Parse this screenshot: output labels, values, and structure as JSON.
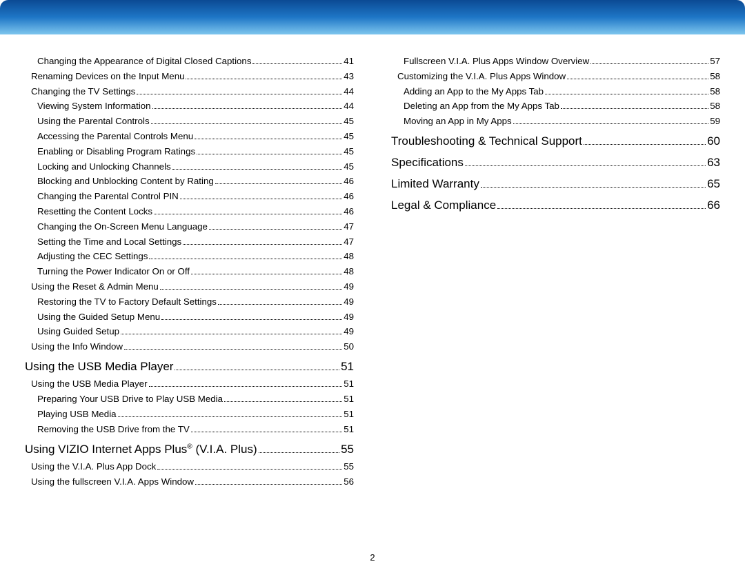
{
  "page_number": "2",
  "columns": [
    [
      {
        "level": 2,
        "type": "item",
        "label": "Changing the Appearance of Digital Closed Captions",
        "page": "41"
      },
      {
        "level": 1,
        "type": "item",
        "label": "Renaming Devices on the Input Menu",
        "page": "43"
      },
      {
        "level": 1,
        "type": "item",
        "label": "Changing the TV Settings",
        "page": "44"
      },
      {
        "level": 2,
        "type": "item",
        "label": "Viewing System Information",
        "page": "44"
      },
      {
        "level": 2,
        "type": "item",
        "label": "Using the Parental Controls",
        "page": "45"
      },
      {
        "level": 2,
        "type": "item",
        "label": "Accessing the Parental Controls Menu",
        "page": "45"
      },
      {
        "level": 2,
        "type": "item",
        "label": "Enabling or Disabling Program Ratings",
        "page": "45"
      },
      {
        "level": 2,
        "type": "item",
        "label": "Locking and Unlocking Channels",
        "page": "45"
      },
      {
        "level": 2,
        "type": "item",
        "label": "Blocking and Unblocking Content by Rating",
        "page": "46"
      },
      {
        "level": 2,
        "type": "item",
        "label": "Changing the Parental Control PIN",
        "page": "46"
      },
      {
        "level": 2,
        "type": "item",
        "label": "Resetting the Content Locks",
        "page": "46"
      },
      {
        "level": 2,
        "type": "item",
        "label": "Changing the On-Screen Menu Language",
        "page": "47"
      },
      {
        "level": 2,
        "type": "item",
        "label": "Setting the Time and Local Settings",
        "page": "47"
      },
      {
        "level": 2,
        "type": "item",
        "label": "Adjusting the CEC Settings",
        "page": "48"
      },
      {
        "level": 2,
        "type": "item",
        "label": "Turning the Power Indicator On or Off",
        "page": "48"
      },
      {
        "level": 1,
        "type": "item",
        "label": "Using the Reset & Admin Menu",
        "page": "49"
      },
      {
        "level": 2,
        "type": "item",
        "label": "Restoring the TV to Factory Default Settings",
        "page": "49"
      },
      {
        "level": 2,
        "type": "item",
        "label": "Using the Guided Setup Menu",
        "page": "49"
      },
      {
        "level": 2,
        "type": "item",
        "label": "Using Guided Setup",
        "page": "49"
      },
      {
        "level": 1,
        "type": "item",
        "label": "Using the Info Window",
        "page": "50"
      },
      {
        "level": 0,
        "type": "section",
        "label": "Using the USB Media Player",
        "page": "51"
      },
      {
        "level": 1,
        "type": "item",
        "label": "Using the USB Media Player",
        "page": "51"
      },
      {
        "level": 2,
        "type": "item",
        "label": "Preparing Your USB Drive to Play USB Media",
        "page": "51"
      },
      {
        "level": 2,
        "type": "item",
        "label": "Playing USB Media",
        "page": "51"
      },
      {
        "level": 2,
        "type": "item",
        "label": "Removing the USB Drive from the TV",
        "page": "51"
      },
      {
        "level": 0,
        "type": "section",
        "label": "Using VIZIO Internet Apps Plus® (V.I.A. Plus)",
        "page": "55"
      },
      {
        "level": 1,
        "type": "item",
        "label": "Using the V.I.A. Plus App Dock",
        "page": "55"
      },
      {
        "level": 1,
        "type": "item",
        "label": "Using the fullscreen V.I.A. Apps Window",
        "page": "56"
      }
    ],
    [
      {
        "level": 2,
        "type": "item",
        "label": "Fullscreen V.I.A. Plus Apps Window Overview",
        "page": "57"
      },
      {
        "level": 1,
        "type": "item",
        "label": "Customizing the V.I.A. Plus Apps Window",
        "page": "58"
      },
      {
        "level": 2,
        "type": "item",
        "label": "Adding an App to the My Apps Tab",
        "page": "58"
      },
      {
        "level": 2,
        "type": "item",
        "label": "Deleting an App from the My Apps Tab",
        "page": "58"
      },
      {
        "level": 2,
        "type": "item",
        "label": "Moving an App in My Apps",
        "page": "59"
      },
      {
        "level": 0,
        "type": "section",
        "label": "Troubleshooting & Technical Support",
        "page": "60"
      },
      {
        "level": 0,
        "type": "section",
        "label": "Specifications",
        "page": "63"
      },
      {
        "level": 0,
        "type": "section",
        "label": "Limited Warranty",
        "page": "65"
      },
      {
        "level": 0,
        "type": "section",
        "label": "Legal & Compliance",
        "page": "66"
      }
    ]
  ]
}
